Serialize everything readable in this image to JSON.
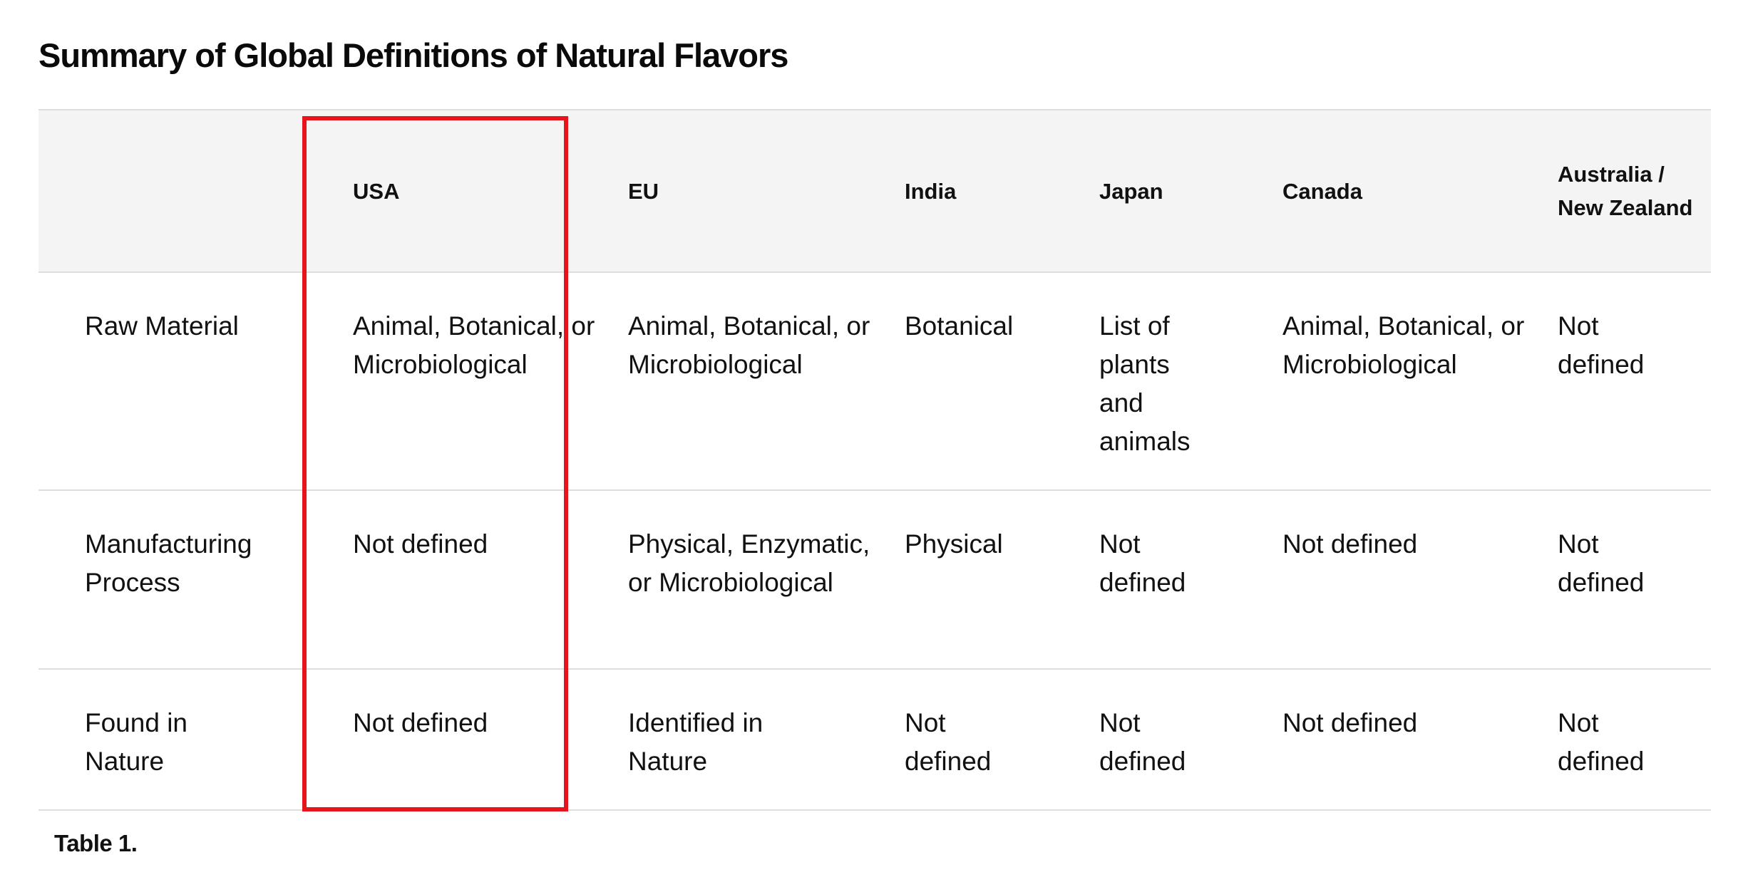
{
  "title": "Summary of Global Definitions of Natural Flavors",
  "table": {
    "headers": [
      "",
      "USA",
      "EU",
      "India",
      "Japan",
      "Canada",
      "Australia / New Zealand"
    ],
    "rows": [
      {
        "label": "Raw Material",
        "cells": [
          "Animal, Botanical, or Microbiological",
          "Animal, Botanical, or Microbiological",
          "Botanical",
          "List of plants and animals",
          "Animal, Botanical, or Microbiological",
          "Not defined"
        ]
      },
      {
        "label": "Manufacturing Process",
        "cells": [
          "Not defined",
          "Physical, Enzymatic, or Microbiological",
          "Physical",
          "Not defined",
          "Not defined",
          "Not defined"
        ]
      },
      {
        "label": "Found in Nature",
        "cells": [
          "Not defined",
          "Identified in Nature",
          "Not defined",
          "Not defined",
          "Not defined",
          "Not defined"
        ]
      }
    ]
  },
  "caption": "Table 1.",
  "highlight": {
    "column": "USA",
    "color": "#e8141b"
  }
}
